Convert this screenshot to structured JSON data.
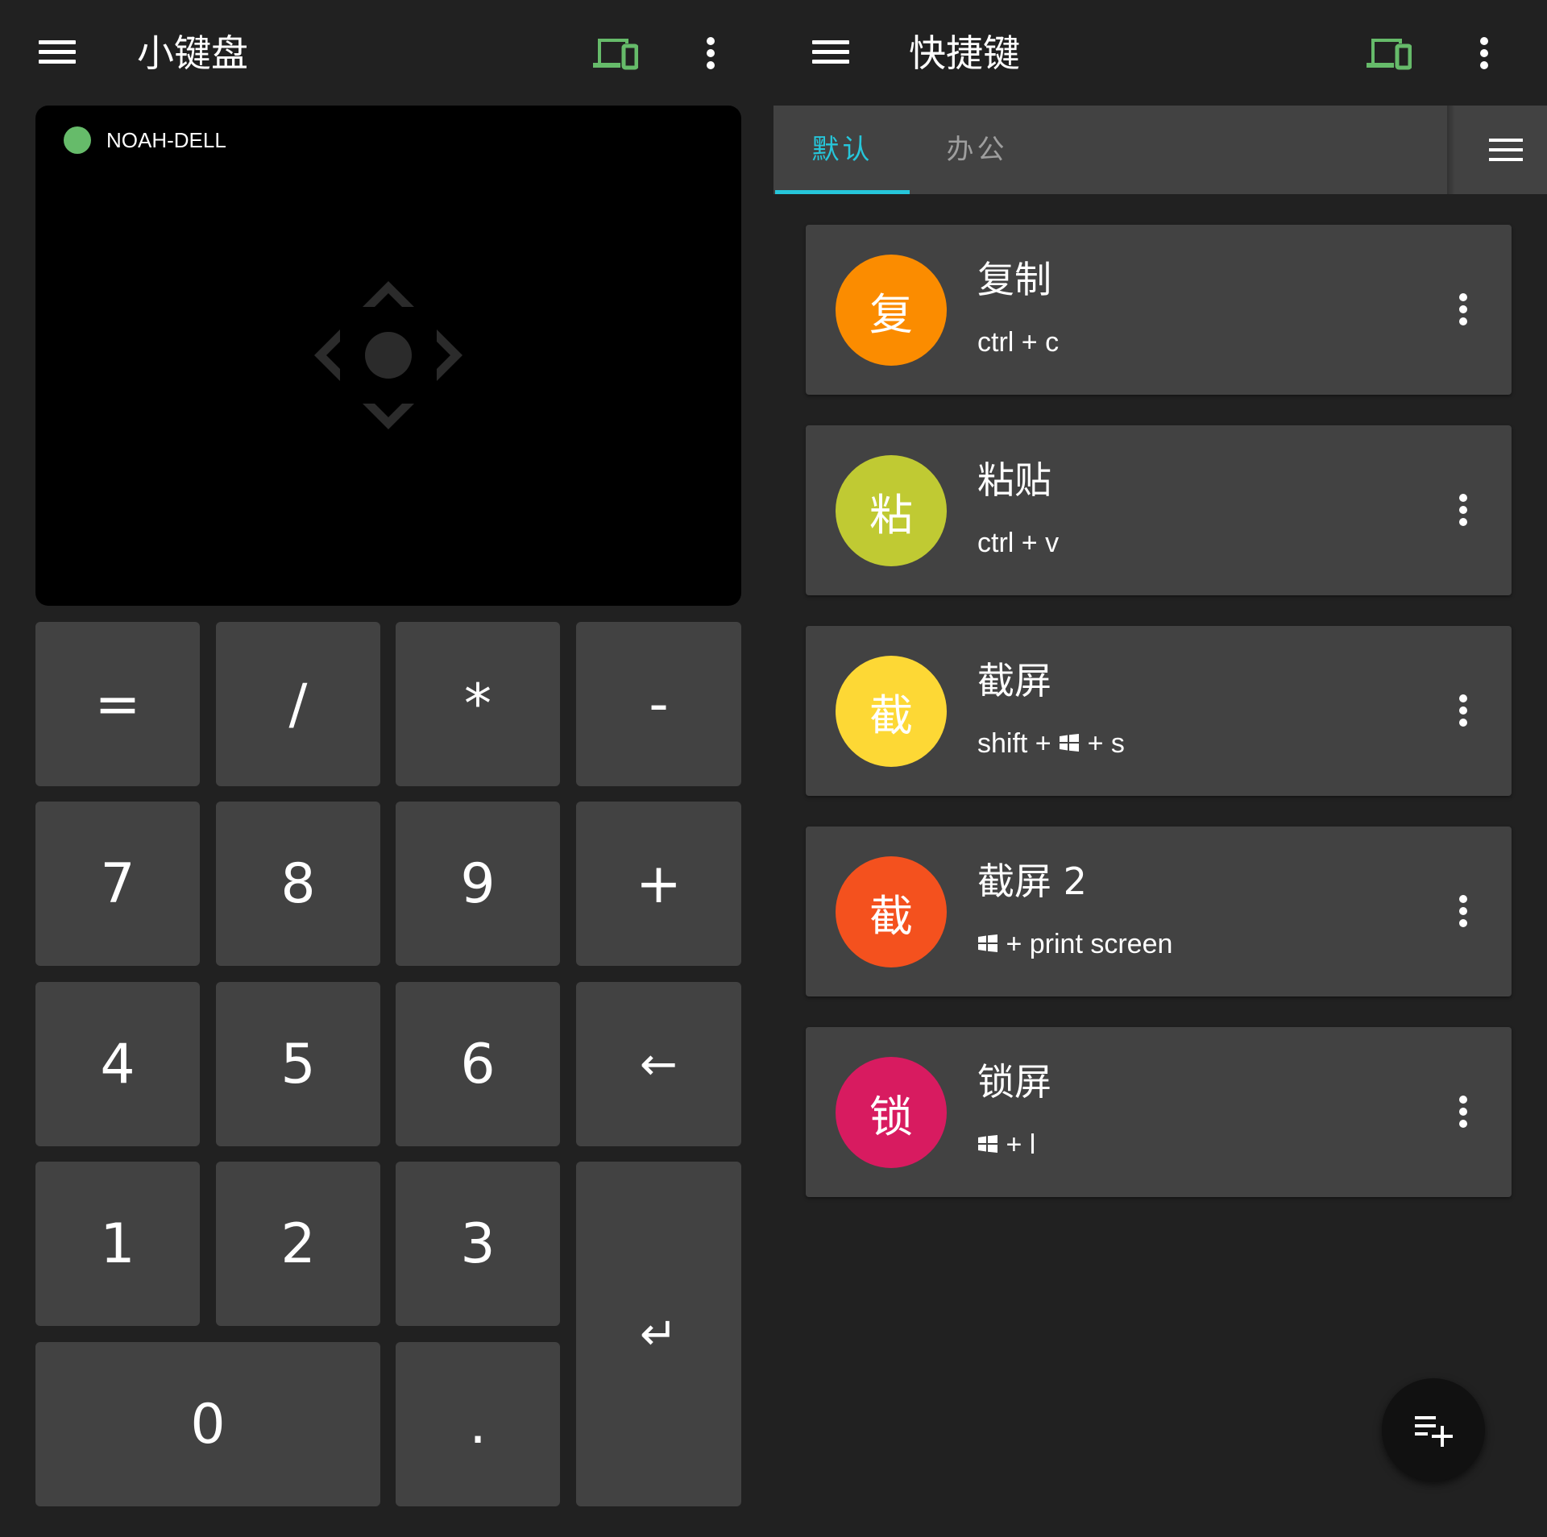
{
  "left_screen": {
    "title": "小键盘",
    "device": {
      "name": "NOAH-DELL",
      "status_color": "#66bb6a"
    },
    "icons": {
      "menu": "menu-icon",
      "devices": "devices-icon",
      "more": "more-vert-icon",
      "touchpad": "move-arrows-icon"
    },
    "keys": {
      "equals": "=",
      "divide": "/",
      "multiply": "*",
      "minus": "-",
      "seven": "7",
      "eight": "8",
      "nine": "9",
      "plus": "+",
      "four": "4",
      "five": "5",
      "six": "6",
      "backspace": "←",
      "one": "1",
      "two": "2",
      "three": "3",
      "enter": "↵",
      "zero": "0",
      "decimal": "."
    }
  },
  "right_screen": {
    "title": "快捷键",
    "tabs": [
      {
        "label": "默认",
        "selected": true
      },
      {
        "label": "办公",
        "selected": false
      }
    ],
    "accent_color": "#26c6da",
    "shortcuts": [
      {
        "avatar": "复",
        "title": "复制",
        "keys": "ctrl + c",
        "color": "#fb8c00"
      },
      {
        "avatar": "粘",
        "title": "粘贴",
        "keys": "ctrl + v",
        "color": "#c0ca33"
      },
      {
        "avatar": "截",
        "title": "截屏",
        "keys_before": "shift +",
        "keys_after": "+ s",
        "color": "#fdd835"
      },
      {
        "avatar": "截",
        "title": "截屏 2",
        "keys_after": "+ print screen",
        "color": "#f4511e"
      },
      {
        "avatar": "锁",
        "title": "锁屏",
        "keys_after": "+ l",
        "color": "#d81b60"
      }
    ],
    "fab_icon": "playlist-add-icon"
  }
}
